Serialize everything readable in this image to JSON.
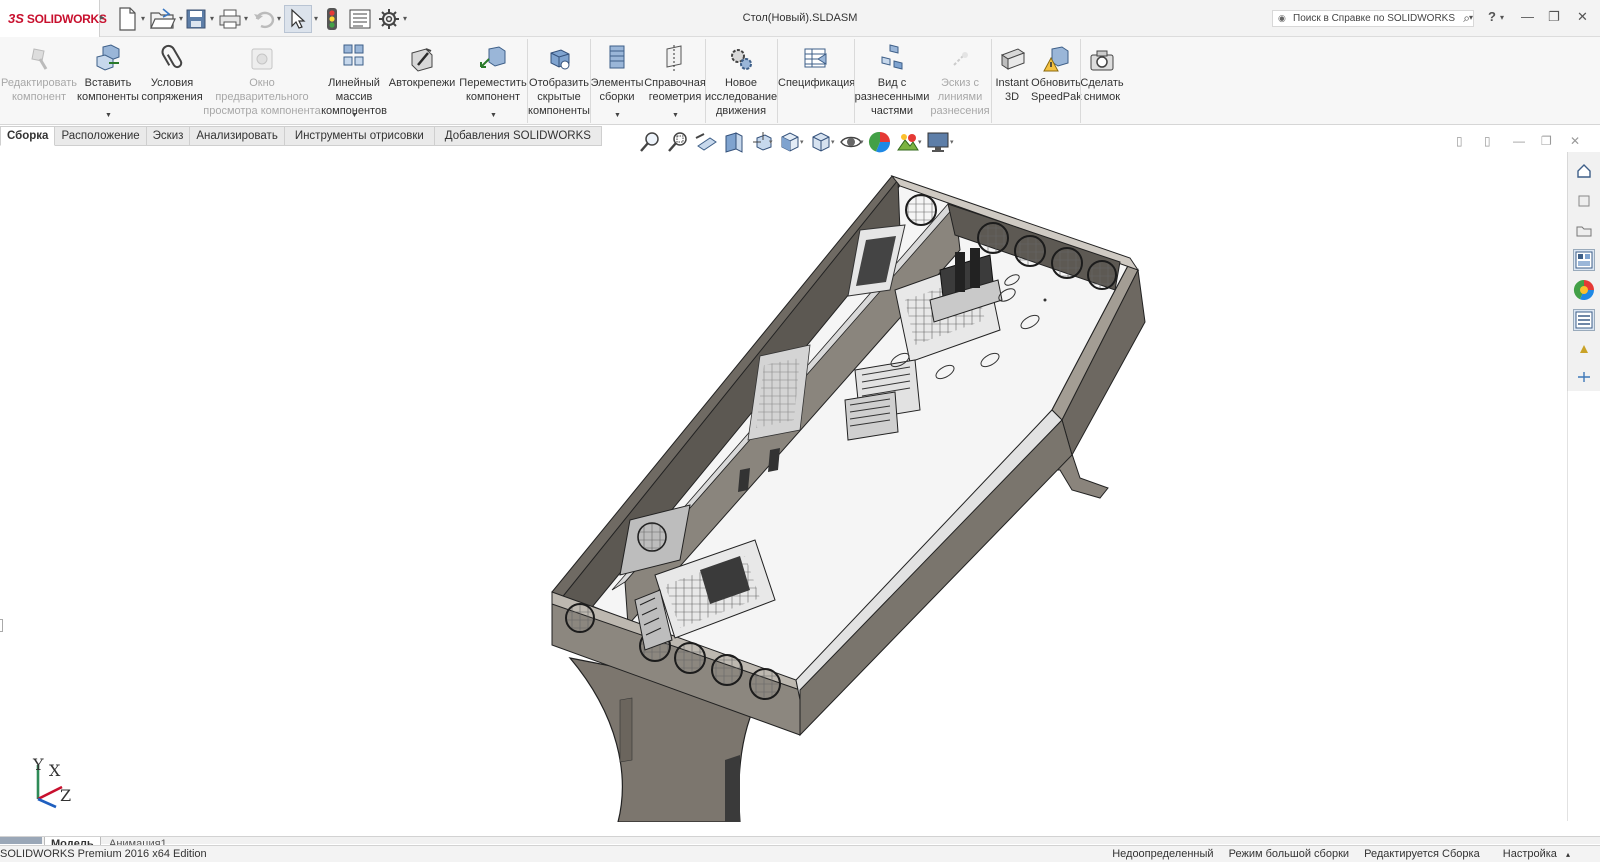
{
  "app": {
    "logo_ds": "3S",
    "logo_text": "SOLIDWORKS",
    "document_title": "Стол(Новый).SLDASM",
    "help_search_placeholder": "Поиск в Справке по SOLIDWORKS",
    "help_label": "?"
  },
  "quick_access": [
    {
      "name": "new-document-icon",
      "has_dropdown": true
    },
    {
      "name": "open-folder-icon",
      "has_dropdown": true
    },
    {
      "name": "save-icon",
      "has_dropdown": true
    },
    {
      "name": "print-icon",
      "has_dropdown": true
    },
    {
      "name": "undo-icon",
      "has_dropdown": true
    },
    {
      "name": "select-pointer-icon",
      "has_dropdown": true
    },
    {
      "name": "rebuild-traffic-light-icon"
    },
    {
      "name": "file-properties-icon"
    },
    {
      "name": "options-gear-icon",
      "has_dropdown": true
    }
  ],
  "commands": [
    {
      "id": "edit-component",
      "label": "Редактировать\nкомпонент",
      "enabled": false,
      "icon": "edit-component-icon"
    },
    {
      "id": "insert-components",
      "label": "Вставить\nкомпоненты",
      "enabled": true,
      "dropdown": true,
      "icon": "insert-components-icon"
    },
    {
      "id": "mate",
      "label": "Условия\nсопряжения",
      "enabled": true,
      "icon": "paperclip-mate-icon"
    },
    {
      "id": "preview-window",
      "label": "Окно\nпредварительного\nпросмотра компонента",
      "enabled": false,
      "icon": "component-preview-icon"
    },
    {
      "id": "linear-pattern",
      "label": "Линейный\nмассив\nкомпонентов",
      "enabled": true,
      "dropdown": true,
      "icon": "linear-pattern-icon"
    },
    {
      "id": "smart-fasteners",
      "label": "Автокрепежи",
      "enabled": true,
      "icon": "smart-fasteners-icon"
    },
    {
      "id": "move-component",
      "label": "Переместить\nкомпонент",
      "enabled": true,
      "dropdown": true,
      "icon": "move-component-icon"
    },
    {
      "id": "show-hidden",
      "label": "Отобразить\nскрытые\nкомпоненты",
      "enabled": true,
      "icon": "show-hidden-components-icon"
    },
    {
      "id": "assembly-features",
      "label": "Элементы\nсборки",
      "enabled": true,
      "dropdown": true,
      "icon": "assembly-features-icon"
    },
    {
      "id": "reference-geometry",
      "label": "Справочная\nгеометрия",
      "enabled": true,
      "dropdown": true,
      "icon": "reference-geometry-icon"
    },
    {
      "id": "new-motion-study",
      "label": "Новое\nисследование\nдвижения",
      "enabled": true,
      "icon": "motion-study-gears-icon"
    },
    {
      "id": "bom",
      "label": "Спецификация",
      "enabled": true,
      "icon": "bill-of-materials-icon"
    },
    {
      "id": "exploded-view",
      "label": "Вид с\nразнесенными\nчастями",
      "enabled": true,
      "icon": "exploded-view-icon"
    },
    {
      "id": "explode-line-sketch",
      "label": "Эскиз с\nлиниями\nразнесения",
      "enabled": false,
      "icon": "explode-line-sketch-icon"
    },
    {
      "id": "instant3d",
      "label": "Instant\n3D",
      "enabled": true,
      "icon": "instant3d-icon"
    },
    {
      "id": "update-speedpak",
      "label": "Обновить\nSpeedPak",
      "enabled": true,
      "icon": "speedpak-warning-icon"
    },
    {
      "id": "take-snapshot",
      "label": "Сделать\nснимок",
      "enabled": true,
      "icon": "camera-snapshot-icon"
    }
  ],
  "tabs": [
    {
      "label": "Сборка",
      "active": true
    },
    {
      "label": "Расположение"
    },
    {
      "label": "Эскиз"
    },
    {
      "label": "Анализировать"
    },
    {
      "label": "Инструменты отрисовки"
    },
    {
      "label": "Добавления SOLIDWORKS"
    }
  ],
  "view_toolbar": [
    "zoom-to-fit-icon",
    "zoom-to-area-icon",
    "previous-view-icon",
    "section-view-icon",
    "dynamic-annotation-views-icon",
    "view-orientation-cube-icon",
    "display-style-icon",
    "hide-show-items-icon",
    "edit-appearance-sphere-icon",
    "apply-scene-icon",
    "view-settings-monitor-icon"
  ],
  "task_pane": [
    "solidworks-resources-home-icon",
    "design-library-icon",
    "file-explorer-icon",
    "view-palette-icon",
    "appearances-scenes-icon",
    "custom-properties-icon",
    "solidworks-forum-icon",
    "pdm-search-icon"
  ],
  "triad": {
    "y": "Y",
    "x": "X",
    "z": "Z",
    "y_color": "#2e8b57",
    "x_color": "#c8102e",
    "z_color": "#1f5fbf"
  },
  "bottom_tabs": [
    {
      "label": "Модель",
      "active": true
    },
    {
      "label": "Анимация1"
    }
  ],
  "status": {
    "edition": "SOLIDWORKS Premium 2016 x64 Edition",
    "underdefined": "Недоопределенный",
    "large_assembly_mode": "Режим большой сборки",
    "editing": "Редактируется Сборка",
    "customize": "Настройка"
  },
  "colors": {
    "brand": "#c8102e",
    "metal": "#7a746c",
    "metal_light": "#f4f4f4",
    "edge": "#222222"
  }
}
